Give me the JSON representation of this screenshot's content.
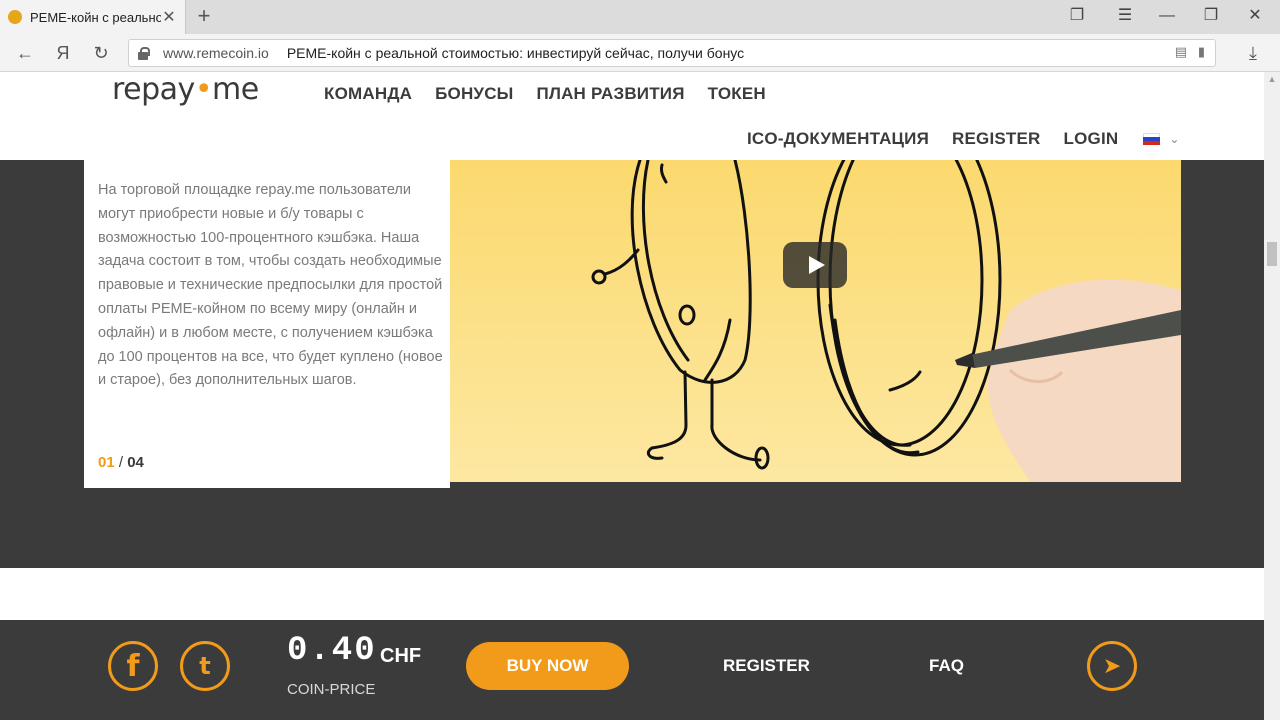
{
  "browser": {
    "tab_title": "РЕМЕ-койн с реальной",
    "tab_close": "✕",
    "new_tab": "+",
    "url_domain": "www.remecoin.io",
    "page_title": "РЕМЕ-койн с реальной стоимостью: инвестируй сейчас, получи бонус",
    "back": "←",
    "yandex": "Я",
    "reload": "↻",
    "download": "⤓"
  },
  "header": {
    "logo_left": "repay",
    "logo_dot": "•",
    "logo_right": "me",
    "nav_main": [
      "КОМАНДА",
      "БОНУСЫ",
      "ПЛАН РАЗВИТИЯ",
      "ТОКЕН"
    ],
    "nav_sub": [
      "ICO-ДОКУМЕНТАЦИЯ",
      "REGISTER",
      "LOGIN"
    ],
    "language_chevron": "⌄"
  },
  "slide": {
    "text": "На торговой площадке repay.me пользователи могут приобрести новые и б/у товары с возможностью 100-процентного кэшбэка. Наша задача состоит в том, чтобы создать необходимые правовые и технические предпосылки для простой оплаты РЕМЕ-койном по всему миру (онлайн и офлайн) и в любом месте, с получением кэшбэка до 100 процентов на все, что будет куплено (новое и старое), без дополнительных шагов.",
    "pager_current": "01",
    "pager_sep": " / ",
    "pager_total": "04"
  },
  "footer_bar": {
    "facebook_icon": "f",
    "twitter_icon": "t",
    "price": "0.40",
    "currency": "CHF",
    "price_label": "COIN-PRICE",
    "buy_label": "BUY NOW",
    "register_label": "REGISTER",
    "faq_label": "FAQ",
    "telegram_icon": "➤"
  },
  "colors": {
    "accent": "#f29a19",
    "dark": "#3b3b3b",
    "video_bg": "#fbd96e"
  }
}
